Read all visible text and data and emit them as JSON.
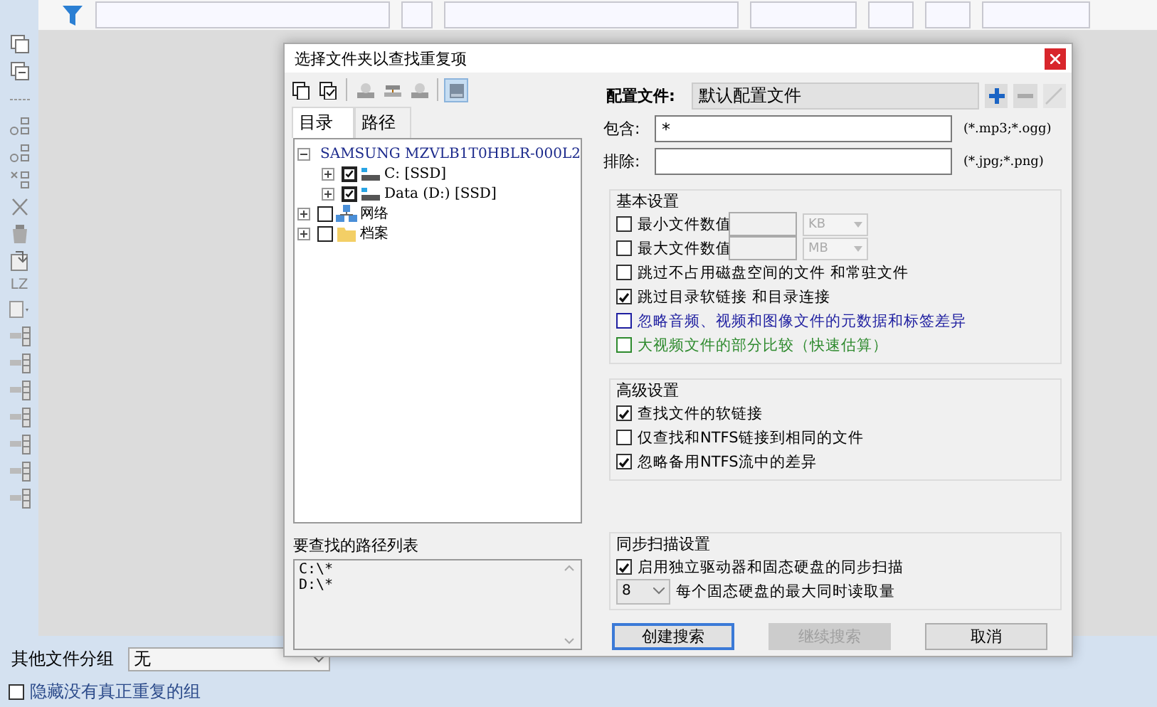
{
  "side_toolbar": {
    "label": "LZ"
  },
  "dialog": {
    "title": "选择文件夹以查找重复项",
    "tool_buttons": [
      {
        "kind": "copy",
        "selected": false
      },
      {
        "kind": "copy-check",
        "selected": false
      },
      {
        "kind": "drive",
        "selected": false
      },
      {
        "kind": "network",
        "selected": false
      },
      {
        "kind": "drive",
        "selected": false
      },
      {
        "kind": "disk",
        "selected": true
      }
    ],
    "tabs": [
      {
        "label": "目录",
        "selected": true
      },
      {
        "label": "路径",
        "selected": false
      }
    ],
    "tree": [
      {
        "label": "SAMSUNG MZVLB1T0HBLR-000L2",
        "kind": "disk",
        "expanded": true,
        "children": [
          {
            "label": "C: [SSD]",
            "kind": "drive",
            "checked": true,
            "expanded": false
          },
          {
            "label": "Data (D:) [SSD]",
            "kind": "drive",
            "checked": true,
            "expanded": false
          }
        ]
      },
      {
        "label": "网络",
        "kind": "network",
        "checked": false,
        "expanded": false
      },
      {
        "label": "档案",
        "kind": "folder",
        "checked": false,
        "expanded": false
      }
    ],
    "path_list": {
      "label": "要查找的路径列表",
      "lines": [
        "C:\\*",
        "D:\\*"
      ]
    },
    "profile": {
      "label": "配置文件:",
      "value": "默认配置文件"
    },
    "include": {
      "label": "包含:",
      "value": "*",
      "hint": "(*.mp3;*.ogg)"
    },
    "exclude": {
      "label": "排除:",
      "hint": "(*.jpg;*.png)"
    },
    "groups": [
      {
        "title": "基本设置",
        "rows": [
          {
            "kind": "size",
            "label": "最小文件数值",
            "checked": false,
            "unit": "KB"
          },
          {
            "kind": "size",
            "label": "最大文件数值",
            "checked": false,
            "unit": "MB"
          },
          {
            "kind": "check",
            "label": "跳过不占用磁盘空间的文件 和常驻文件",
            "checked": false
          },
          {
            "kind": "check",
            "label": "跳过目录软链接 和目录连接",
            "checked": true
          },
          {
            "kind": "check",
            "label": "忽略音频、视频和图像文件的元数据和标签差异",
            "checked": false,
            "color": "#1f1fa0"
          },
          {
            "kind": "check",
            "label": "大视频文件的部分比较（快速估算）",
            "checked": false,
            "color": "#2e8a2e"
          }
        ]
      },
      {
        "title": "高级设置",
        "rows": [
          {
            "kind": "check",
            "label": "查找文件的软链接",
            "checked": true
          },
          {
            "kind": "check",
            "label": "仅查找和NTFS链接到相同的文件",
            "checked": false
          },
          {
            "kind": "check",
            "label": "忽略备用NTFS流中的差异",
            "checked": true
          }
        ]
      },
      {
        "title": "同步扫描设置",
        "rows": [
          {
            "kind": "check",
            "label": "启用独立驱动器和固态硬盘的同步扫描",
            "checked": true
          },
          {
            "kind": "select",
            "value": "8",
            "caption": "每个固态硬盘的最大同时读取量"
          }
        ]
      }
    ],
    "buttons": [
      {
        "label": "创建搜索",
        "disabled": false,
        "default": true
      },
      {
        "label": "继续搜索",
        "disabled": true,
        "default": false
      },
      {
        "label": "取消",
        "disabled": false,
        "default": false
      }
    ]
  },
  "bottom": {
    "group_label": "其他文件分组",
    "group_value": "无",
    "hide_label": "隐藏没有真正重复的组",
    "hide_checked": false
  }
}
